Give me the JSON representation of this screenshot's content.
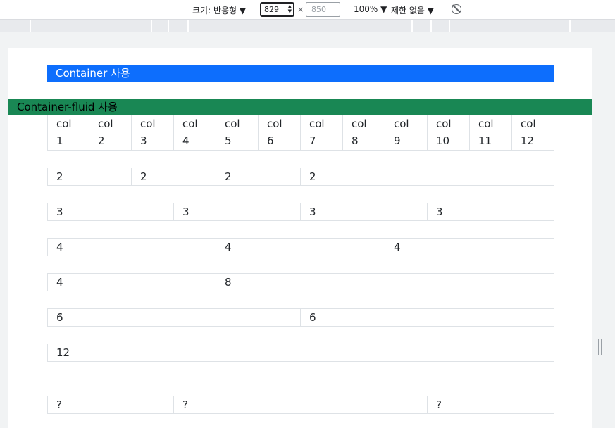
{
  "devtools": {
    "size_label": "크기: 반응형 ▼",
    "width_value": "829",
    "times": "×",
    "height_placeholder": "850",
    "zoom": "100% ▼",
    "throttle": "제한 없음 ▼"
  },
  "page": {
    "container_label": "Container 사용",
    "fluid_label": "Container-fluid 사용",
    "row1": [
      "col\n1",
      "col\n2",
      "col\n3",
      "col\n4",
      "col\n5",
      "col\n6",
      "col\n7",
      "col\n8",
      "col\n9",
      "col\n10",
      "col\n11",
      "col\n12"
    ],
    "row2": [
      "2",
      "2",
      "2",
      "2"
    ],
    "row3": [
      "3",
      "3",
      "3",
      "3"
    ],
    "row4": [
      "4",
      "4",
      "4"
    ],
    "row5": [
      "4",
      "8"
    ],
    "row6": [
      "6",
      "6"
    ],
    "row7": [
      "12"
    ],
    "row8": [
      "?",
      "?",
      "?"
    ]
  },
  "colors": {
    "container_bg": "#0d6efd",
    "fluid_bg": "#198754",
    "cell_border": "#dee2e6"
  }
}
